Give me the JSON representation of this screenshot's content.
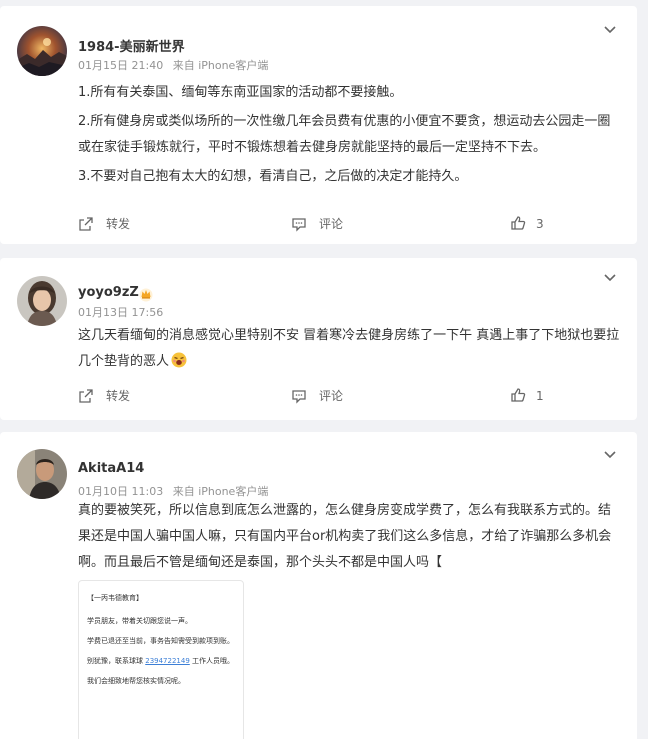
{
  "posts": [
    {
      "username": "1984-美丽新世界",
      "date": "01月15日 21:40",
      "source": "来自 iPhone客户端",
      "paragraphs": [
        "1.所有有关泰国、缅甸等东南亚国家的活动都不要接触。",
        "2.所有健身房或类似场所的一次性缴几年会员费有优惠的小便宜不要贪，想运动去公园走一圈或在家徒手锻炼就行，平时不锻炼想着去健身房就能坚持的最后一定坚持不下去。",
        "3.不要对自己抱有太大的幻想，看清自己，之后做的决定才能持久。"
      ],
      "actions": {
        "repost": "转发",
        "comment": "评论",
        "likes": "3"
      }
    },
    {
      "username": "yoyo9zZ",
      "date": "01月13日 17:56",
      "text": "这几天看缅甸的消息感觉心里特别不安 冒着寒冷去健身房练了一下午 真遇上事了下地狱也要拉几个垫背的恶人",
      "actions": {
        "repost": "转发",
        "comment": "评论",
        "likes": "1"
      }
    },
    {
      "username": "AkitaA14",
      "date": "01月10日 11:03",
      "source": "来自 iPhone客户端",
      "text": "真的要被笑死，所以信息到底怎么泄露的，怎么健身房变成学费了，怎么有我联系方式的。结果还是中国人骗中国人嘛，只有国内平台or机构卖了我们这么多信息，才给了诈骗那么多机会啊。而且最后不管是缅甸还是泰国，那个头头不都是中国人吗【",
      "attachment": {
        "line1": "【一丙韦德教育】",
        "line2": "学员朋友，带着关切跟您说一声。",
        "line3": "学费已退还至当前，事务告知需受到款项到账。",
        "line4_before": "别犹豫，联系球球 ",
        "line4_link": "2394722149",
        "line4_after": " 工作人员哦。",
        "line5": "我们会细致地帮您核实情况呢。"
      }
    }
  ],
  "colors": {
    "text": "#333333",
    "meta": "#939393",
    "link": "#3d7fd6",
    "crown": "#f5a623"
  },
  "icons": [
    "chevron-down-icon",
    "repost-icon",
    "comment-icon",
    "like-icon",
    "crown-badge-icon",
    "emoji-icon"
  ]
}
